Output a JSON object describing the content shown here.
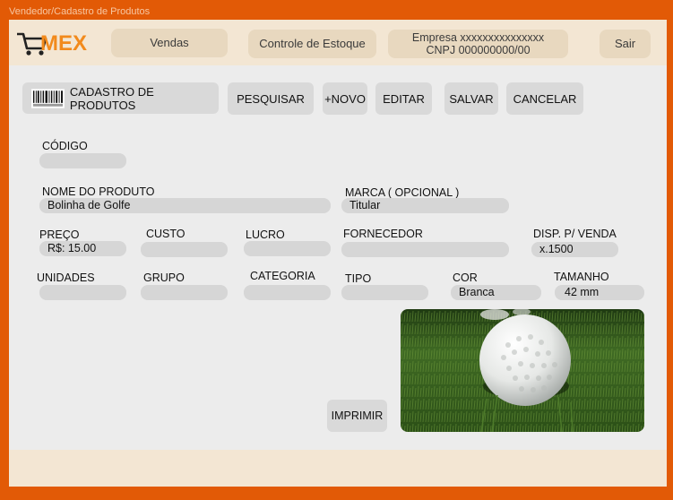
{
  "window": {
    "title": "Vendedor/Cadastro de Produtos"
  },
  "header": {
    "logo_text": "MEX",
    "nav_vendas": "Vendas",
    "nav_estoque": "Controle de Estoque",
    "company_line1": "Empresa xxxxxxxxxxxxxxx",
    "company_line2": "CNPJ 000000000/00",
    "logout": "Sair"
  },
  "toolbar": {
    "section_label": "CADASTRO DE PRODUTOS",
    "pesquisar": "PESQUISAR",
    "novo": "+NOVO",
    "editar": "EDITAR",
    "salvar": "SALVAR",
    "cancelar": "CANCELAR"
  },
  "form": {
    "codigo": {
      "label": "CÓDIGO",
      "value": ""
    },
    "nome_produto": {
      "label": "NOME DO PRODUTO",
      "value": "Bolinha de Golfe"
    },
    "marca": {
      "label": "MARCA ( OPCIONAL )",
      "value": "Titular"
    },
    "preco": {
      "label": "PREÇO",
      "value": "R$: 15.00"
    },
    "custo": {
      "label": "CUSTO",
      "value": ""
    },
    "lucro": {
      "label": "LUCRO",
      "value": ""
    },
    "fornecedor": {
      "label": "FORNECEDOR",
      "value": ""
    },
    "disp_venda": {
      "label": "DISP. P/ VENDA",
      "value": "x.1500"
    },
    "unidades": {
      "label": "UNIDADES",
      "value": ""
    },
    "grupo": {
      "label": "GRUPO",
      "value": ""
    },
    "categoria": {
      "label": "CATEGORIA",
      "value": ""
    },
    "tipo": {
      "label": "TIPO",
      "value": ""
    },
    "cor": {
      "label": "COR",
      "value": "Branca"
    },
    "tamanho": {
      "label": "TAMANHO",
      "value": "42 mm"
    }
  },
  "actions": {
    "imprimir": "IMPRIMIR"
  },
  "image": {
    "subject": "golf-ball-on-grass"
  },
  "colors": {
    "brand_orange": "#e25a06",
    "header_bg": "#f3e6d3",
    "panel_bg": "#ececec"
  }
}
